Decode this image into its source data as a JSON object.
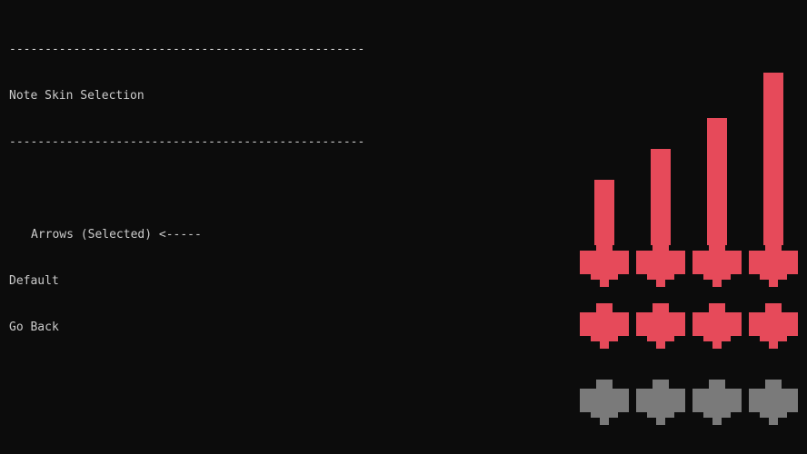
{
  "screen": {
    "divider": "--------------------------------------------------",
    "title": "Note Skin Selection"
  },
  "menu": {
    "items": [
      {
        "label": "Arrows (Selected) <-----",
        "selected": true
      },
      {
        "label": "Default",
        "selected": false
      },
      {
        "label": "Go Back",
        "selected": false
      }
    ]
  },
  "preview": {
    "lanes": 4,
    "note_color": "#e64a5a",
    "receptor_color": "#7a7a7a",
    "background": "#0c0c0c",
    "hold_note_icons": [
      "left-arrow-hold-icon",
      "down-arrow-hold-icon",
      "up-arrow-hold-icon",
      "right-arrow-hold-icon"
    ],
    "note_icons": [
      "left-arrow-icon",
      "down-arrow-icon",
      "up-arrow-icon",
      "right-arrow-icon"
    ],
    "receptor_icons": [
      "left-receptor-icon",
      "down-receptor-icon",
      "up-receptor-icon",
      "right-receptor-icon"
    ]
  }
}
